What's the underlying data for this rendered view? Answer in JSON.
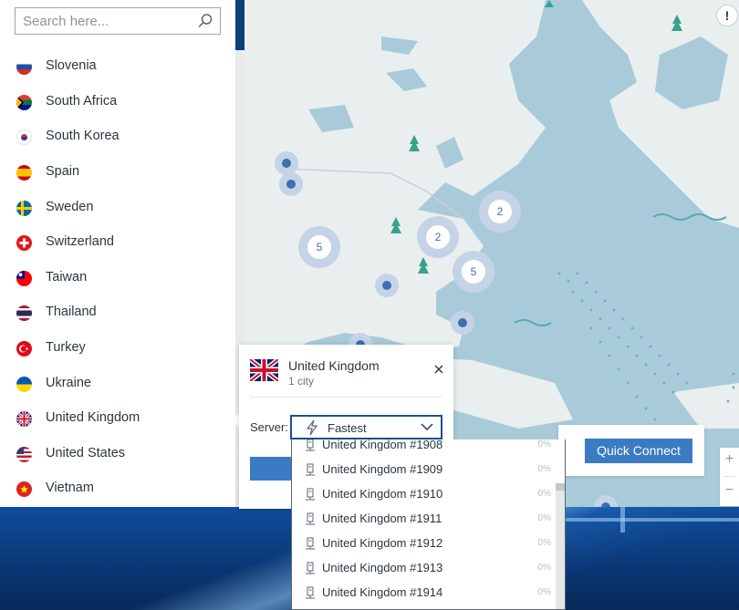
{
  "search": {
    "placeholder": "Search here..."
  },
  "countries": [
    {
      "name": "Slovenia",
      "flag": "slovenia-flag-icon"
    },
    {
      "name": "South Africa",
      "flag": "south-africa-flag-icon"
    },
    {
      "name": "South Korea",
      "flag": "south-korea-flag-icon"
    },
    {
      "name": "Spain",
      "flag": "spain-flag-icon"
    },
    {
      "name": "Sweden",
      "flag": "sweden-flag-icon"
    },
    {
      "name": "Switzerland",
      "flag": "switzerland-flag-icon"
    },
    {
      "name": "Taiwan",
      "flag": "taiwan-flag-icon"
    },
    {
      "name": "Thailand",
      "flag": "thailand-flag-icon"
    },
    {
      "name": "Turkey",
      "flag": "turkey-flag-icon"
    },
    {
      "name": "Ukraine",
      "flag": "ukraine-flag-icon"
    },
    {
      "name": "United Kingdom",
      "flag": "united-kingdom-flag-icon"
    },
    {
      "name": "United States",
      "flag": "united-states-flag-icon"
    },
    {
      "name": "Vietnam",
      "flag": "vietnam-flag-icon"
    }
  ],
  "popup": {
    "country": "United Kingdom",
    "cities": "1 city",
    "server_label": "Server:",
    "server_value": "Fastest"
  },
  "servers": [
    {
      "name": "United Kingdom #1908",
      "load": "0%"
    },
    {
      "name": "United Kingdom #1909",
      "load": "0%"
    },
    {
      "name": "United Kingdom #1910",
      "load": "0%"
    },
    {
      "name": "United Kingdom #1911",
      "load": "0%"
    },
    {
      "name": "United Kingdom #1912",
      "load": "0%"
    },
    {
      "name": "United Kingdom #1913",
      "load": "0%"
    },
    {
      "name": "United Kingdom #1914",
      "load": "0%"
    }
  ],
  "quick_connect": {
    "label": "Quick Connect"
  },
  "map": {
    "clusters": [
      "2",
      "2",
      "5",
      "5"
    ],
    "info": "!"
  },
  "zoom": {
    "plus": "+",
    "minus": "−"
  },
  "colors": {
    "accent": "#3b7bc4",
    "map_water": "#a9cbd9",
    "map_land": "#e9eeef",
    "pin": "#3d6fb1"
  }
}
